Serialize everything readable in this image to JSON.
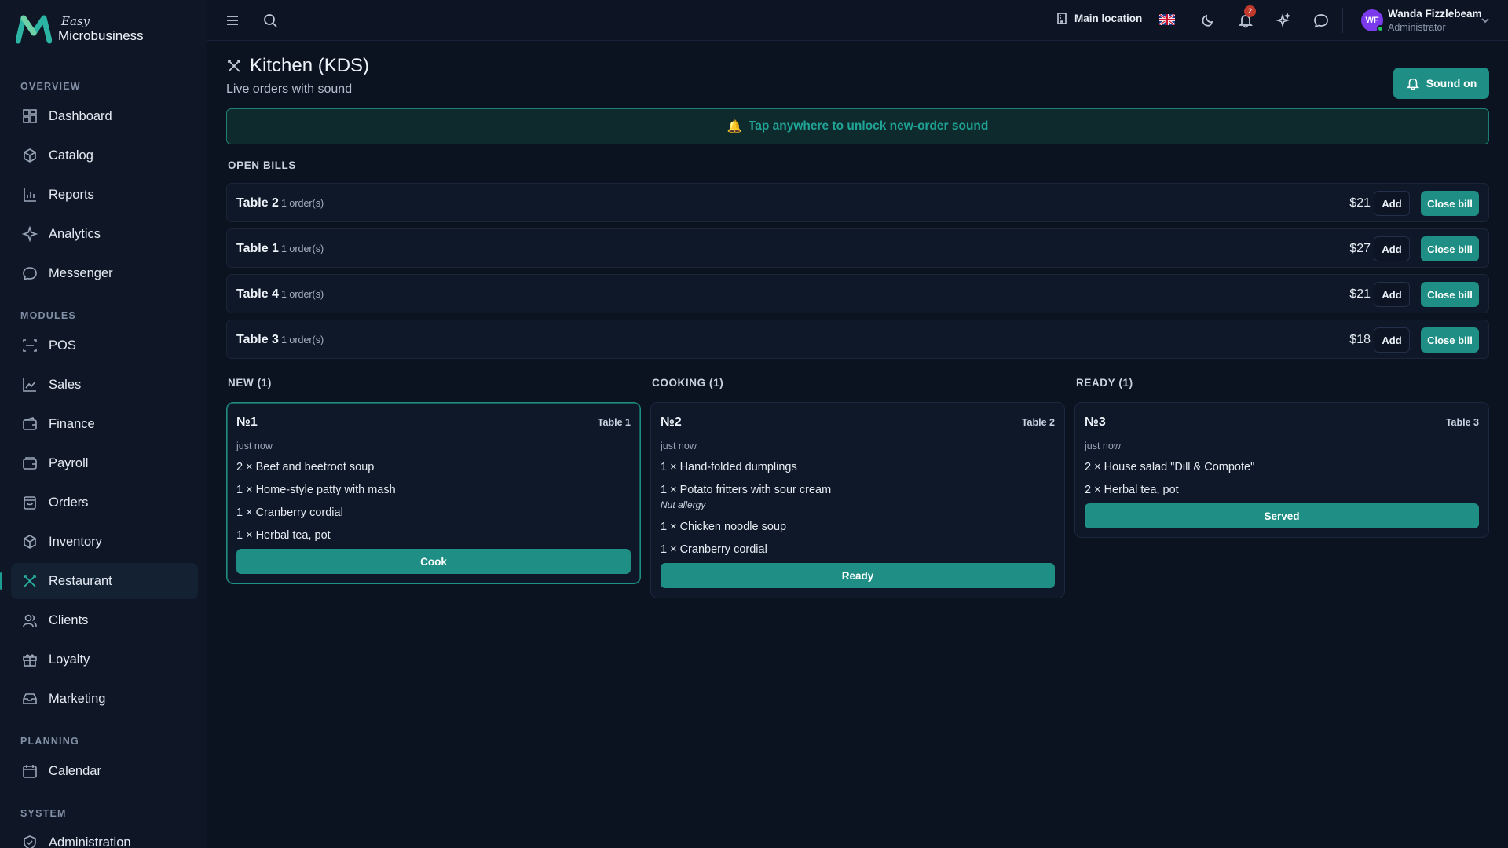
{
  "brand": {
    "easy": "Easy",
    "name": "Microbusiness"
  },
  "sidebar": {
    "sections": {
      "overview": "OVERVIEW",
      "modules": "MODULES",
      "planning": "PLANNING",
      "system": "SYSTEM"
    },
    "items": [
      {
        "label": "Dashboard",
        "icon": "dashboard-icon"
      },
      {
        "label": "Catalog",
        "icon": "catalog-icon"
      },
      {
        "label": "Reports",
        "icon": "reports-icon"
      },
      {
        "label": "Analytics",
        "icon": "analytics-icon"
      },
      {
        "label": "Messenger",
        "icon": "messenger-icon"
      },
      {
        "label": "POS",
        "icon": "pos-icon"
      },
      {
        "label": "Sales",
        "icon": "sales-icon"
      },
      {
        "label": "Finance",
        "icon": "finance-icon"
      },
      {
        "label": "Payroll",
        "icon": "payroll-icon"
      },
      {
        "label": "Orders",
        "icon": "orders-icon"
      },
      {
        "label": "Inventory",
        "icon": "inventory-icon"
      },
      {
        "label": "Restaurant",
        "icon": "restaurant-icon",
        "active": true
      },
      {
        "label": "Clients",
        "icon": "clients-icon"
      },
      {
        "label": "Loyalty",
        "icon": "loyalty-icon"
      },
      {
        "label": "Marketing",
        "icon": "marketing-icon"
      },
      {
        "label": "Calendar",
        "icon": "calendar-icon"
      },
      {
        "label": "Administration",
        "icon": "administration-icon"
      }
    ]
  },
  "topbar": {
    "location": "Main location",
    "notifications_count": "2",
    "user": {
      "initials": "WF",
      "name": "Wanda Fizzlebeam",
      "role": "Administrator"
    }
  },
  "page": {
    "title": "Kitchen (KDS)",
    "subtitle": "Live orders with sound",
    "sound_button": "Sound on",
    "banner": "Tap anywhere to unlock new-order sound",
    "banner_icon": "🔔"
  },
  "open_bills": {
    "label": "OPEN BILLS",
    "add_label": "Add",
    "close_label": "Close bill",
    "rows": [
      {
        "table": "Table 2",
        "orders": "1 order(s)",
        "amount": "$21"
      },
      {
        "table": "Table 1",
        "orders": "1 order(s)",
        "amount": "$27"
      },
      {
        "table": "Table 4",
        "orders": "1 order(s)",
        "amount": "$21"
      },
      {
        "table": "Table 3",
        "orders": "1 order(s)",
        "amount": "$18"
      }
    ]
  },
  "columns": [
    {
      "label": "NEW (1)",
      "card": {
        "number": "№1",
        "table": "Table 1",
        "time": "just now",
        "items": [
          "2 × Beef and beetroot soup",
          "1 × Home-style patty with mash",
          "1 × Cranberry cordial",
          "1 × Herbal tea, pot"
        ],
        "button": "Cook"
      }
    },
    {
      "label": "COOKING (1)",
      "card": {
        "number": "№2",
        "table": "Table 2",
        "time": "just now",
        "items": [
          "1 × Hand-folded dumplings",
          "1 × Potato fritters with sour cream",
          "1 × Chicken noodle soup",
          "1 × Cranberry cordial"
        ],
        "note": "Nut allergy",
        "button": "Ready"
      }
    },
    {
      "label": "READY (1)",
      "card": {
        "number": "№3",
        "table": "Table 3",
        "time": "just now",
        "items": [
          "2 × House salad \"Dill & Compote\"",
          "2 × Herbal tea, pot"
        ],
        "button": "Served"
      }
    }
  ],
  "colors": {
    "accent": "#1f8f85",
    "background": "#0b1220",
    "sidebar": "#0f1726"
  }
}
